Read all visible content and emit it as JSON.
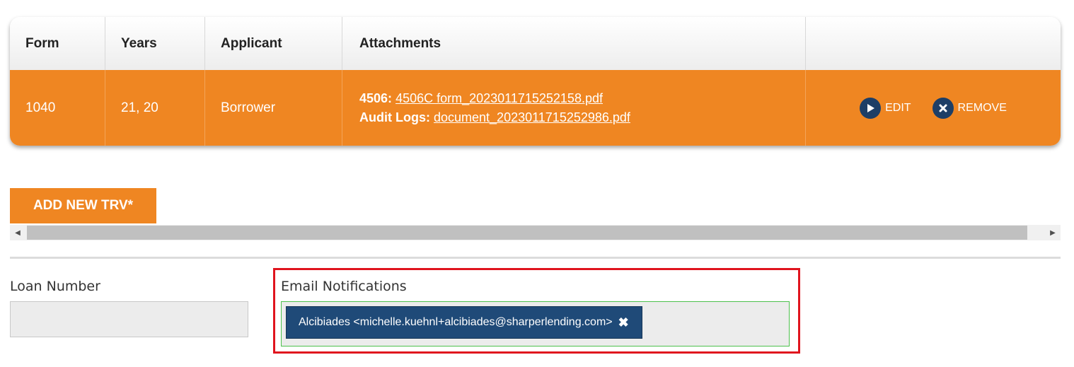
{
  "table": {
    "headers": [
      "Form",
      "Years",
      "Applicant",
      "Attachments",
      ""
    ],
    "rows": [
      {
        "form": "1040",
        "years": "21, 20",
        "applicant": "Borrower",
        "attachments": [
          {
            "label": "4506:",
            "file": "4506C form_2023011715252158.pdf"
          },
          {
            "label": "Audit Logs:",
            "file": "document_2023011715252986.pdf"
          }
        ],
        "actions": {
          "edit": "EDIT",
          "remove": "REMOVE"
        }
      }
    ]
  },
  "add_button": "ADD NEW TRV*",
  "form": {
    "loan_number": {
      "label": "Loan Number",
      "value": ""
    },
    "email_notifications": {
      "label": "Email Notifications",
      "tags": [
        "Alcibiades <michelle.kuehnl+alcibiades@sharperlending.com>"
      ],
      "remove_glyph": "✖"
    }
  },
  "colors": {
    "accent_orange": "#ef8622",
    "navy": "#1d3e66",
    "highlight_red": "#e0141e",
    "focus_green": "#4cc04c"
  },
  "icons": {
    "edit": "play-circle-icon",
    "remove": "x-circle-icon",
    "scroll_left": "triangle-left-icon",
    "scroll_right": "triangle-right-icon"
  }
}
